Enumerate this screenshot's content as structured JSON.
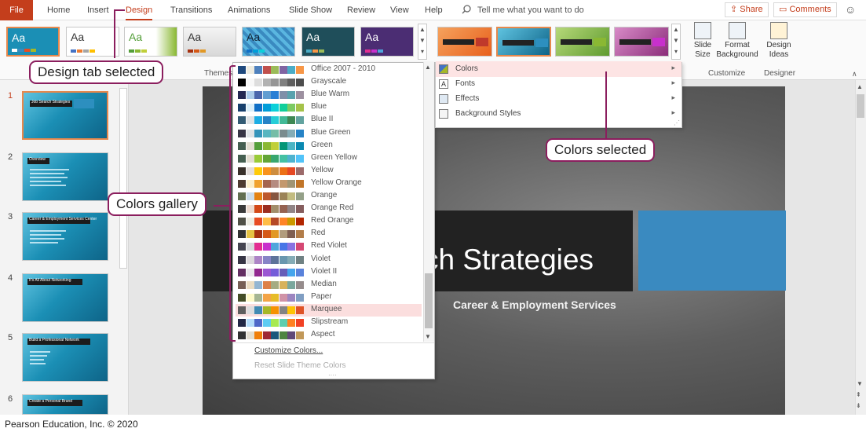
{
  "ribbon_tabs": {
    "file": "File",
    "home": "Home",
    "insert": "Insert",
    "design": "Design",
    "transitions": "Transitions",
    "animations": "Animations",
    "slide_show": "Slide Show",
    "review": "Review",
    "view": "View",
    "help": "Help"
  },
  "tell_me": "Tell me what you want to do",
  "share": "Share",
  "comments": "Comments",
  "themes": [
    "Aa",
    "Aa",
    "Aa",
    "Aa",
    "Aa",
    "Aa",
    "Aa"
  ],
  "groups": {
    "themes": "Themes",
    "customize": "Customize",
    "designer": "Designer"
  },
  "buttons": {
    "slide_size": "Slide Size",
    "format_background": "Format Background",
    "design_ideas": "Design Ideas"
  },
  "submenu": [
    {
      "label": "Colors",
      "icon": "color-palette-icon"
    },
    {
      "label": "Fonts",
      "icon": "font-icon"
    },
    {
      "label": "Effects",
      "icon": "effects-icon"
    },
    {
      "label": "Background Styles",
      "icon": "background-styles-icon"
    }
  ],
  "colors_gallery": [
    {
      "label": "Office 2007 - 2010",
      "swatch": [
        "#1f497d",
        "#eeece1",
        "#4f81bd",
        "#c0504d",
        "#9bbb59",
        "#8064a2",
        "#4bacc6",
        "#f79646"
      ]
    },
    {
      "label": "Grayscale",
      "swatch": [
        "#000000",
        "#f8f8f8",
        "#dddddd",
        "#b2b2b2",
        "#969696",
        "#808080",
        "#5f5f5f",
        "#4d4d4d"
      ]
    },
    {
      "label": "Blue Warm",
      "swatch": [
        "#242852",
        "#acccea",
        "#4a66ac",
        "#629dd1",
        "#297fd5",
        "#7f8fa9",
        "#5aa2ae",
        "#9d90a0"
      ]
    },
    {
      "label": "Blue",
      "swatch": [
        "#17406d",
        "#dbeff9",
        "#0f6fc6",
        "#009dd9",
        "#0bd0d9",
        "#10cf9b",
        "#7cca62",
        "#a5c249"
      ]
    },
    {
      "label": "Blue II",
      "swatch": [
        "#335b74",
        "#dfe3e5",
        "#1cade4",
        "#2683c6",
        "#27ced7",
        "#42ba97",
        "#3e8853",
        "#62a39f"
      ]
    },
    {
      "label": "Blue Green",
      "swatch": [
        "#373545",
        "#dfe3e5",
        "#3494ba",
        "#58b6c0",
        "#75bda7",
        "#7a8c8e",
        "#84acb6",
        "#2683c6"
      ]
    },
    {
      "label": "Green",
      "swatch": [
        "#455f51",
        "#e3ded1",
        "#549e39",
        "#8ab833",
        "#c0cf3a",
        "#029676",
        "#4ab5c4",
        "#0989b1"
      ]
    },
    {
      "label": "Green Yellow",
      "swatch": [
        "#455f51",
        "#e3ded1",
        "#99cb38",
        "#63a537",
        "#37a76f",
        "#44c1a3",
        "#4eb3cf",
        "#51c3f9"
      ]
    },
    {
      "label": "Yellow",
      "swatch": [
        "#39302a",
        "#e5dedb",
        "#ffca08",
        "#f8931d",
        "#ce8d3e",
        "#ec7016",
        "#e64823",
        "#9c6a6a"
      ]
    },
    {
      "label": "Yellow Orange",
      "swatch": [
        "#4e3b30",
        "#fbeec9",
        "#f0a22e",
        "#a5644e",
        "#b58b80",
        "#c3986d",
        "#a19574",
        "#c17529"
      ]
    },
    {
      "label": "Orange",
      "swatch": [
        "#637052",
        "#ccddea",
        "#e48312",
        "#bd582c",
        "#865640",
        "#9b8357",
        "#c2bc80",
        "#94a088"
      ]
    },
    {
      "label": "Orange Red",
      "swatch": [
        "#3a3a3a",
        "#eddbd0",
        "#d34817",
        "#9b2d1f",
        "#a28e6a",
        "#956251",
        "#918485",
        "#855d5d"
      ]
    },
    {
      "label": "Red Orange",
      "swatch": [
        "#505046",
        "#eeece1",
        "#e84c22",
        "#ffbd47",
        "#b64926",
        "#ff8427",
        "#cc9900",
        "#b22600"
      ]
    },
    {
      "label": "Red",
      "swatch": [
        "#323232",
        "#e5c243",
        "#a5300f",
        "#d55816",
        "#e19825",
        "#b19c7d",
        "#7f5f52",
        "#b27d49"
      ]
    },
    {
      "label": "Red Violet",
      "swatch": [
        "#454551",
        "#d8d9dc",
        "#e32d91",
        "#c830cc",
        "#4ea6dc",
        "#4775e7",
        "#8971e1",
        "#d54773"
      ]
    },
    {
      "label": "Violet",
      "swatch": [
        "#373545",
        "#dcd8dc",
        "#ad84c6",
        "#8784c7",
        "#5d739a",
        "#6997af",
        "#84acb6",
        "#6f8183"
      ]
    },
    {
      "label": "Violet II",
      "swatch": [
        "#632e62",
        "#eae5eb",
        "#92278f",
        "#9b57d3",
        "#755dd9",
        "#665eb8",
        "#45a5ed",
        "#5982db"
      ]
    },
    {
      "label": "Median",
      "swatch": [
        "#775f55",
        "#ebddc3",
        "#94b6d2",
        "#dd8047",
        "#a5ab81",
        "#d8b25c",
        "#7ba79d",
        "#968c8c"
      ]
    },
    {
      "label": "Paper",
      "swatch": [
        "#444d26",
        "#fefac9",
        "#a5b592",
        "#f3a447",
        "#e7bc29",
        "#d092a7",
        "#9c85c0",
        "#809ec2"
      ]
    },
    {
      "label": "Marquee",
      "swatch": [
        "#5e5e5e",
        "#ddddde",
        "#418ab3",
        "#a6b727",
        "#f69200",
        "#838383",
        "#fec306",
        "#df5327"
      ]
    },
    {
      "label": "Slipstream",
      "swatch": [
        "#212745",
        "#b4dcfa",
        "#4e67c8",
        "#5eccf3",
        "#a7ea52",
        "#5dceaf",
        "#ff8021",
        "#f14124"
      ]
    },
    {
      "label": "Aspect",
      "swatch": [
        "#323232",
        "#e3ded1",
        "#f07f09",
        "#9f2936",
        "#1b587c",
        "#4e8542",
        "#604878",
        "#c19859"
      ]
    }
  ],
  "gallery_footer": {
    "customize": "Customize Colors...",
    "reset": "Reset Slide Theme Colors"
  },
  "slide": {
    "title": "ch Strategies",
    "subtitle": "Career & Employment Services"
  },
  "thumbnails": [
    {
      "num": "1",
      "title": "Job Search Strategies"
    },
    {
      "num": "2",
      "title": "Overview"
    },
    {
      "num": "3",
      "title": "Career & Employment Services Center"
    },
    {
      "num": "4",
      "title": "It's All About Networking"
    },
    {
      "num": "5",
      "title": "Build a Professional Network"
    },
    {
      "num": "6",
      "title": "Create a Personal Brand"
    }
  ],
  "callouts": {
    "design": "Design tab selected",
    "colors_selected": "Colors selected",
    "gallery": "Colors gallery"
  },
  "footer": "Pearson Education, Inc. © 2020"
}
